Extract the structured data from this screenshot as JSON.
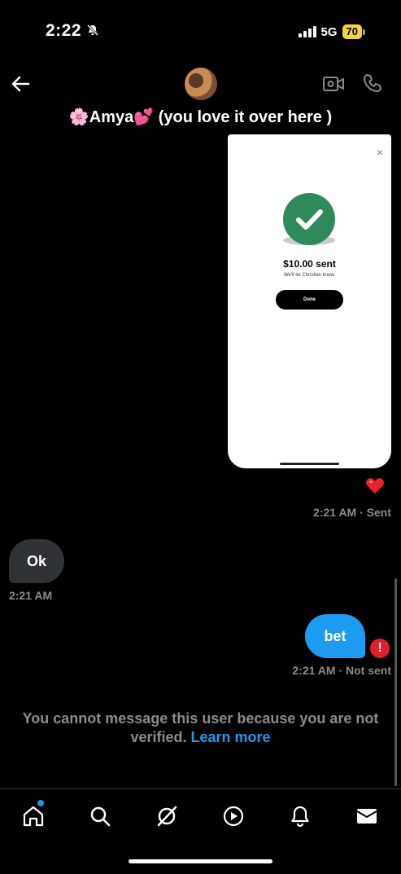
{
  "status_bar": {
    "time": "2:22",
    "network": "5G",
    "battery": "70"
  },
  "header": {
    "name": "🌸Amya💕 (you love it over here )"
  },
  "image_message": {
    "amount": "$10.00 sent",
    "note": "We'll let Christian know.",
    "button": "Done",
    "close": "×"
  },
  "messages": [
    {
      "text": "",
      "meta": "2:21 AM · Sent"
    },
    {
      "text": "Ok",
      "meta": "2:21 AM"
    },
    {
      "text": "bet",
      "meta": "2:21 AM · Not sent"
    }
  ],
  "notice": {
    "text": "You cannot message this user because you are not verified.",
    "link": "Learn more"
  },
  "colors": {
    "accent": "#1d9bf0",
    "error": "#e0202a",
    "bubble_received": "#2f3336"
  },
  "icons": [
    "back-arrow-icon",
    "video-icon",
    "phone-icon",
    "heart-icon",
    "error-icon",
    "home-icon",
    "search-icon",
    "grok-icon",
    "play-icon",
    "bell-icon",
    "mail-icon"
  ]
}
